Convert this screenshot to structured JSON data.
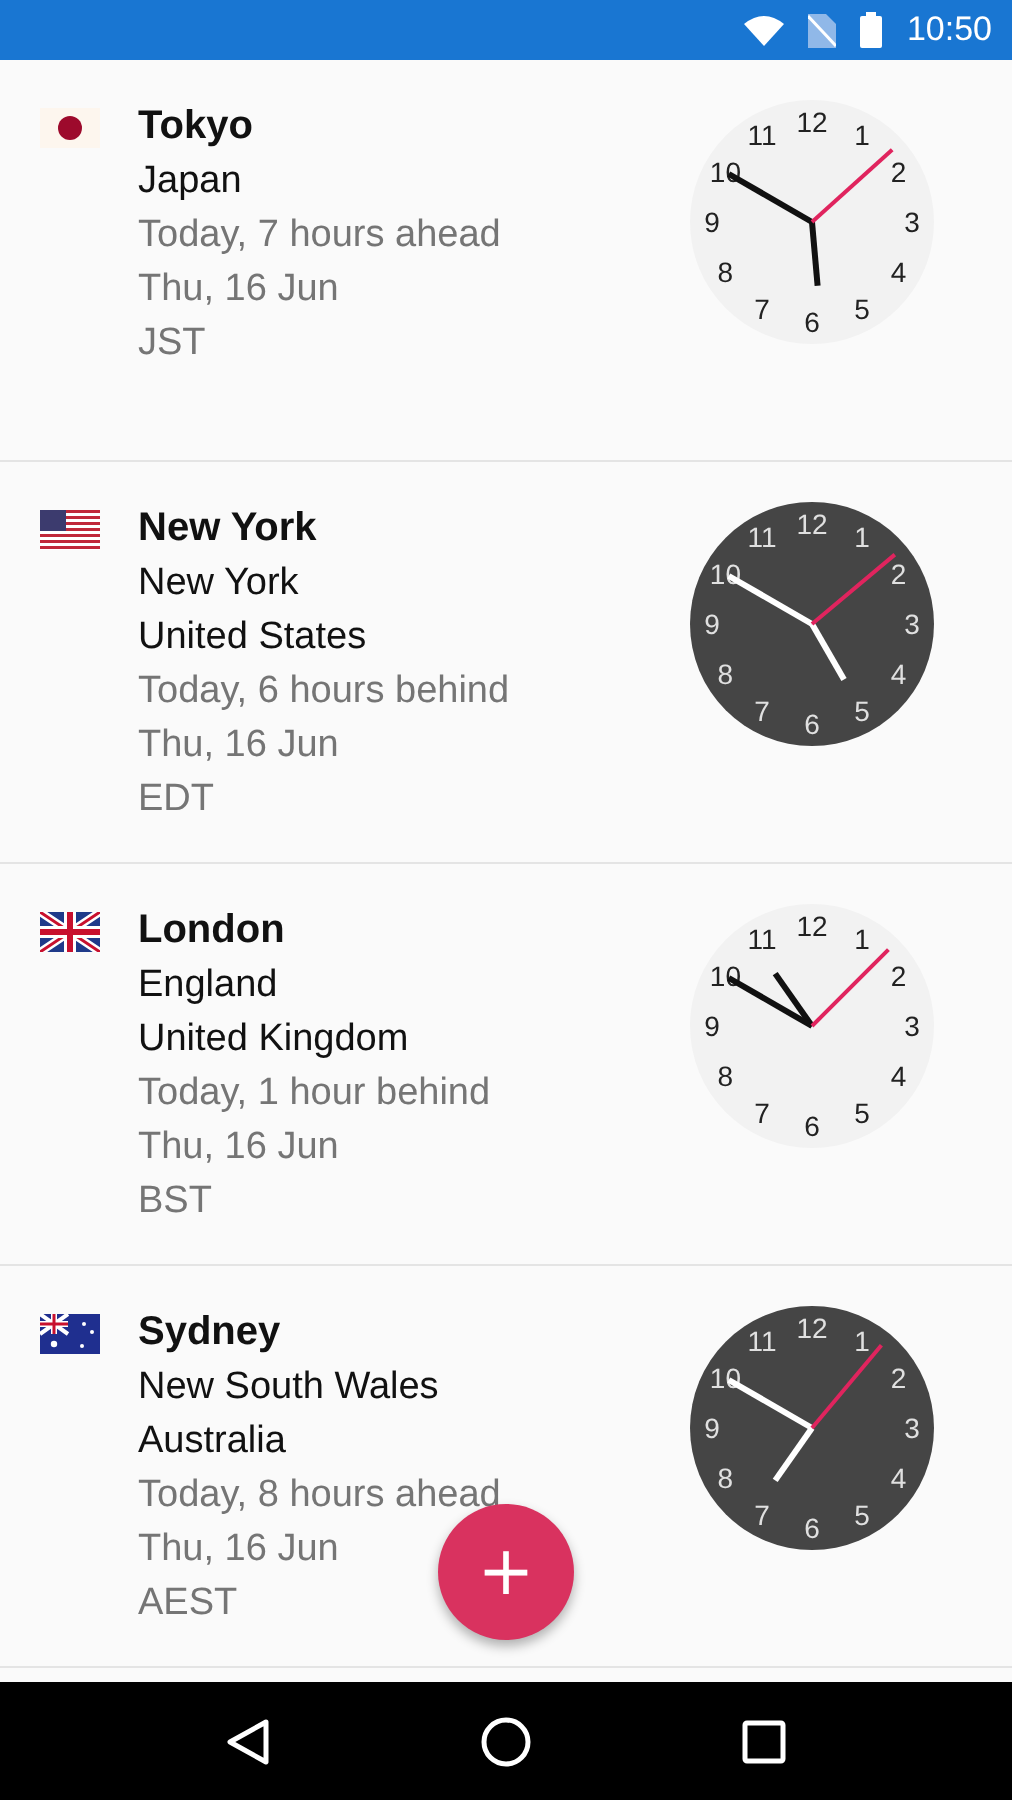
{
  "status_bar": {
    "time": "10:50"
  },
  "cities": [
    {
      "kind": "japan",
      "name": "Tokyo",
      "places": [
        "Japan"
      ],
      "relative": "Today, 7 hours ahead",
      "date": "Thu, 16 Jun",
      "zone": "JST",
      "dark": false,
      "dial": [
        "12",
        "1",
        "2",
        "3",
        "4",
        "5",
        "6",
        "7",
        "8",
        "9",
        "10",
        "11"
      ]
    },
    {
      "kind": "usa",
      "name": "New York",
      "places": [
        "New York",
        "United States"
      ],
      "relative": "Today, 6 hours behind",
      "date": "Thu, 16 Jun",
      "zone": "EDT",
      "dark": true,
      "dial": [
        "12",
        "1",
        "2",
        "3",
        "4",
        "5",
        "6",
        "7",
        "8",
        "9",
        "10",
        "11"
      ]
    },
    {
      "kind": "uk",
      "name": "London",
      "places": [
        "England",
        "United Kingdom"
      ],
      "relative": "Today, 1 hour behind",
      "date": "Thu, 16 Jun",
      "zone": "BST",
      "dark": false,
      "dial": [
        "12",
        "1",
        "2",
        "3",
        "4",
        "5",
        "6",
        "7",
        "8",
        "9",
        "10",
        "11"
      ]
    },
    {
      "kind": "australia",
      "name": "Sydney",
      "places": [
        "New South Wales",
        "Australia"
      ],
      "relative": "Today, 8 hours ahead",
      "date": "Thu, 16 Jun",
      "zone": "AEST",
      "dark": true,
      "dial": [
        "12",
        "1",
        "2",
        "3",
        "4",
        "5",
        "6",
        "7",
        "8",
        "9",
        "10",
        "11"
      ]
    }
  ],
  "fab": {
    "label": "+"
  }
}
